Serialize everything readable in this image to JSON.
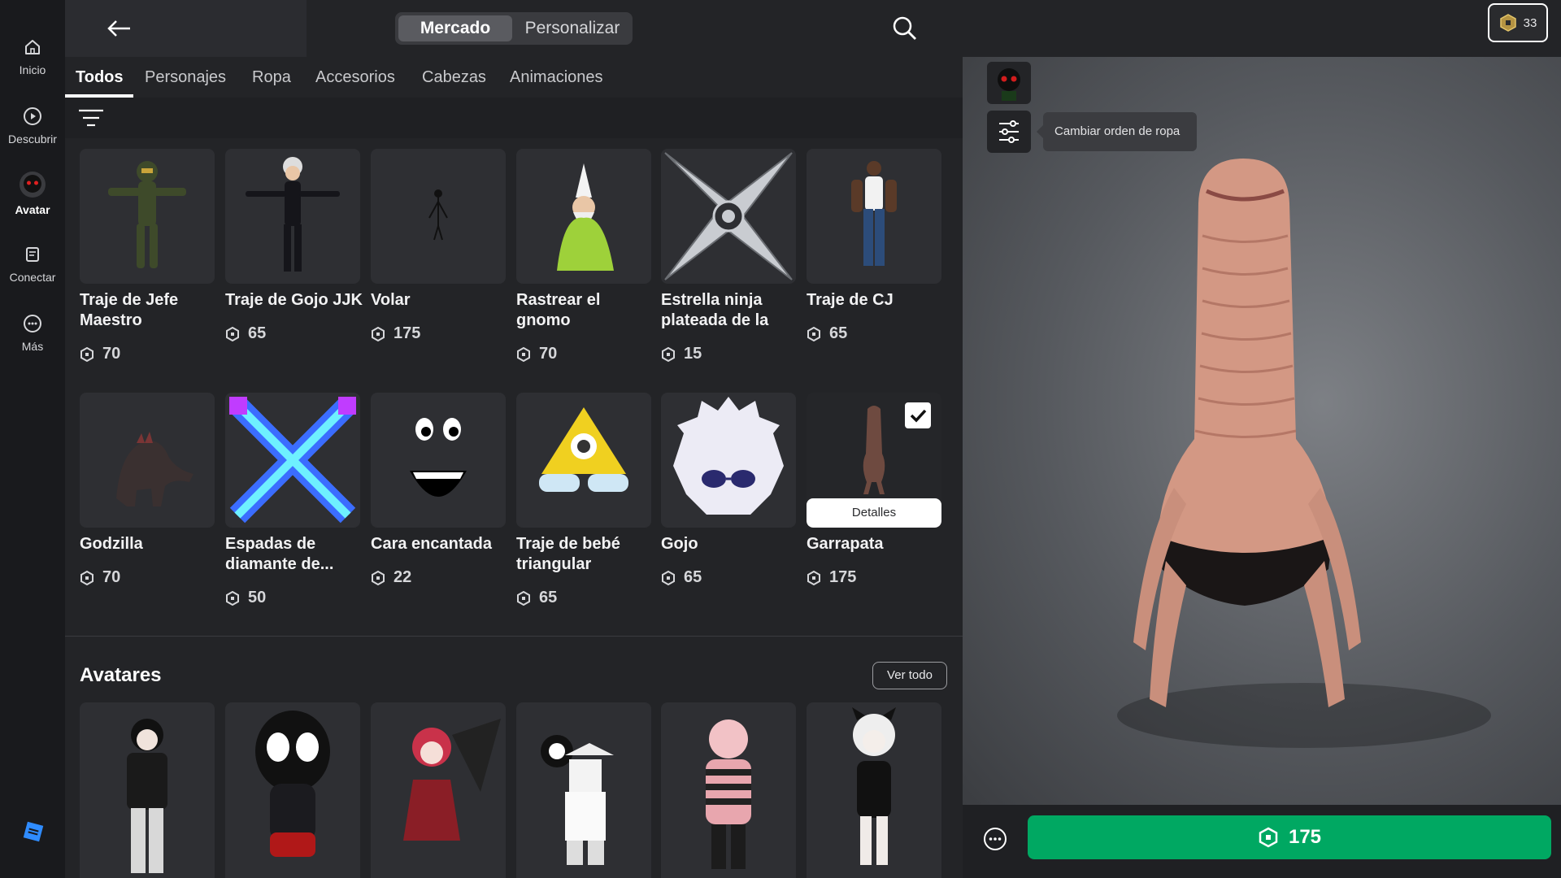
{
  "nav": {
    "items": [
      {
        "label": "Inicio",
        "icon": "home-icon"
      },
      {
        "label": "Descubrir",
        "icon": "play-circle-icon"
      },
      {
        "label": "Avatar",
        "icon": "avatar-icon"
      },
      {
        "label": "Conectar",
        "icon": "chat-icon"
      },
      {
        "label": "Más",
        "icon": "more-icon"
      }
    ],
    "active": "Avatar"
  },
  "header": {
    "segments": [
      "Mercado",
      "Personalizar"
    ],
    "active_segment": "Mercado"
  },
  "tabs": [
    "Todos",
    "Personajes",
    "Ropa",
    "Accesorios",
    "Cabezas",
    "Animaciones"
  ],
  "active_tab": "Todos",
  "items": [
    {
      "name": "Traje de Jefe Maestro",
      "price": "70"
    },
    {
      "name": "Traje de Gojo JJK",
      "price": "65"
    },
    {
      "name": "Volar",
      "price": "175"
    },
    {
      "name": "Rastrear el gnomo",
      "price": "70"
    },
    {
      "name": "Estrella ninja plateada de la",
      "price": "15"
    },
    {
      "name": "Traje de CJ",
      "price": "65"
    },
    {
      "name": "Godzilla",
      "price": "70"
    },
    {
      "name": "Espadas de diamante de...",
      "price": "50"
    },
    {
      "name": "Cara encantada",
      "price": "22"
    },
    {
      "name": "Traje de bebé triangular",
      "price": "65"
    },
    {
      "name": "Gojo",
      "price": "65"
    },
    {
      "name": "Garrapata",
      "price": "175",
      "selected": true,
      "details_label": "Detalles"
    }
  ],
  "avatars_section": {
    "title": "Avatares",
    "see_all": "Ver todo"
  },
  "preview": {
    "robux_balance": "33",
    "tooltip": "Cambiar orden de ropa",
    "buy_price": "175"
  },
  "colors": {
    "buy_green": "#00a862",
    "background": "#232427"
  }
}
